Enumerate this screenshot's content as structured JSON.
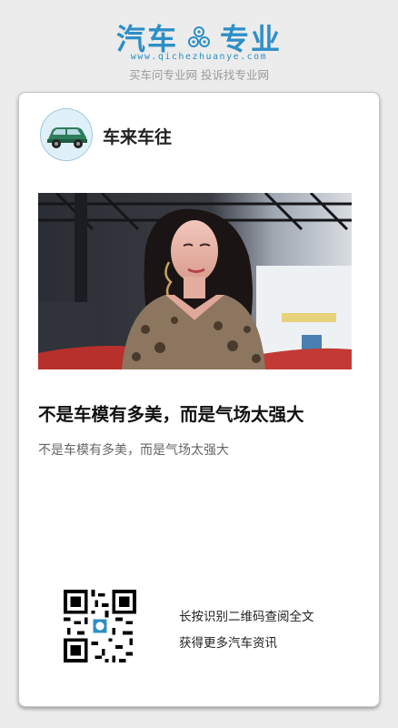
{
  "header": {
    "logo_left": "汽车",
    "logo_right": "专业",
    "url": "www.qichezhuanye.com",
    "slogan": "买车问专业网 投诉找专业网",
    "brand_color": "#2d8fc6"
  },
  "card": {
    "author": "车来车往",
    "avatar_icon": "car-avatar-icon",
    "photo_icon": "auto-show-model-photo",
    "title": "不是车模有多美，而是气场太强大",
    "summary": "不是车模有多美，而是气场太强大",
    "qr_icon": "qr-code-icon",
    "qr_line1": "长按识别二维码查阅全文",
    "qr_line2": "获得更多汽车资讯"
  }
}
